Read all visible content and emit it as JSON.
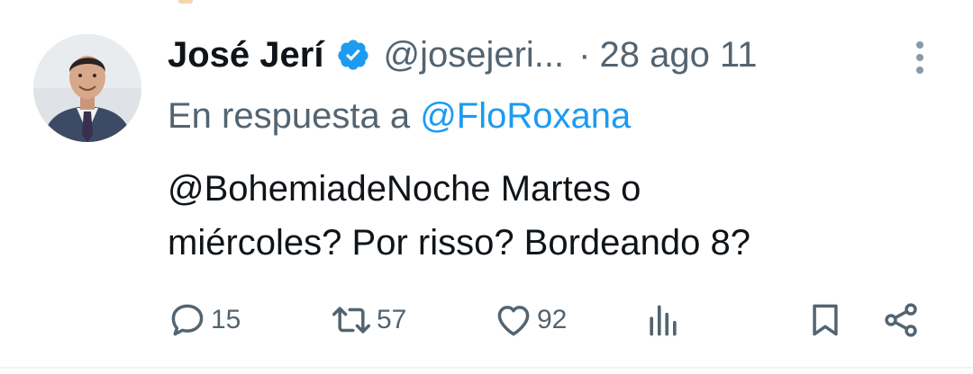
{
  "tweet": {
    "author": {
      "name": "José Jerí",
      "handle": "@josejeri...",
      "verified": true
    },
    "separator": "·",
    "date": "28 ago 11",
    "reply_to": {
      "prefix": "En respuesta a",
      "mention": "@FloRoxana"
    },
    "text_line1": "@BohemiadeNoche Martes o",
    "text_line2": "miércoles? Por risso? Bordeando 8?",
    "stats": {
      "replies": "15",
      "retweets": "57",
      "likes": "92"
    }
  },
  "colors": {
    "accent": "#1d9bf0",
    "text_primary": "#0f1419",
    "text_secondary": "#536471"
  },
  "icons": {
    "verified": "verified-badge-icon",
    "more": "more-vertical-icon",
    "reply": "reply-icon",
    "retweet": "retweet-icon",
    "like": "heart-icon",
    "views": "analytics-icon",
    "bookmark": "bookmark-icon",
    "share": "share-icon"
  }
}
